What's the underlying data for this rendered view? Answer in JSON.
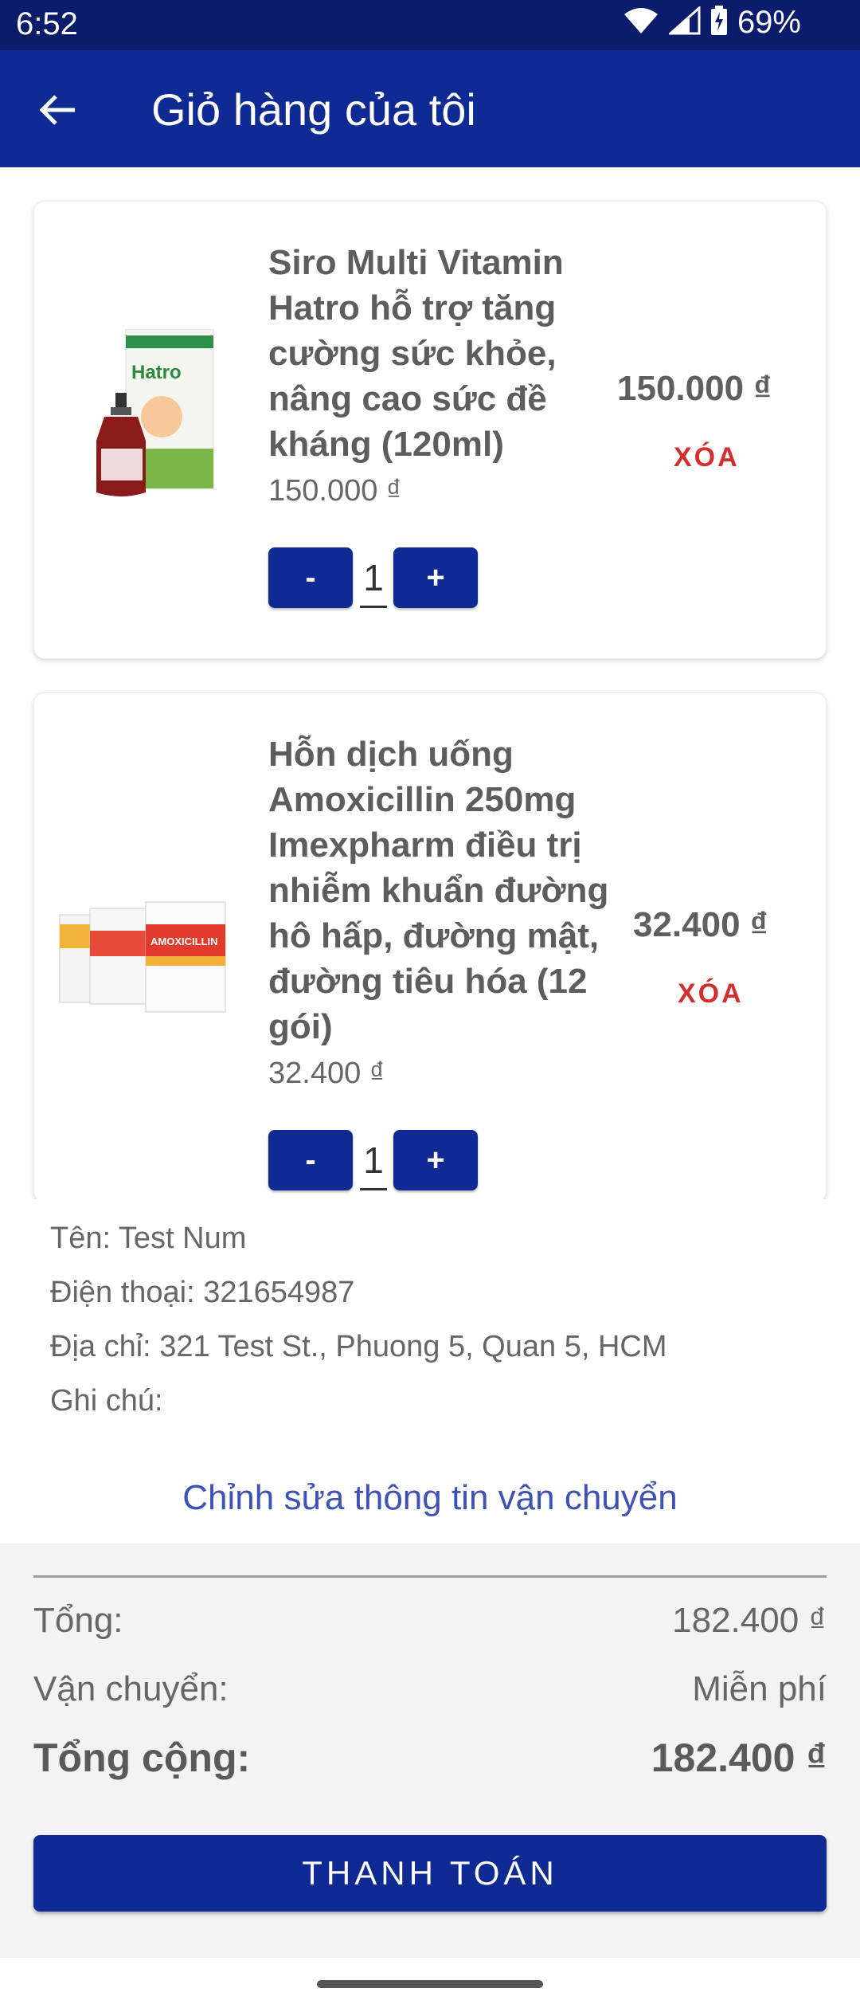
{
  "status_bar": {
    "time": "6:52",
    "battery": "69%"
  },
  "app_bar": {
    "title": "Giỏ hàng của tôi"
  },
  "cart_items": [
    {
      "name": "Siro Multi Vitamin Hatro hỗ trợ tăng cường sức khỏe, nâng cao sức đề kháng (120ml)",
      "unit_price": "150.000 ₫",
      "line_price": "150.000 ₫",
      "remove_label": "XÓA",
      "quantity": "1",
      "minus": "-",
      "plus": "+",
      "image_label": "Hatro"
    },
    {
      "name": "Hỗn dịch uống Amoxicillin 250mg Imexpharm điều trị nhiễm khuẩn đường hô hấp, đường mật, đường tiêu hóa (12 gói)",
      "unit_price": "32.400 ₫",
      "line_price": "32.400 ₫",
      "remove_label": "XÓA",
      "quantity": "1",
      "minus": "-",
      "plus": "+",
      "image_label": "AMOXICILLIN"
    }
  ],
  "shipping_info": {
    "name": "Tên: Test Num",
    "phone": "Điện thoại: 321654987",
    "address": "Địa chỉ: 321 Test St., Phuong 5, Quan 5, HCM",
    "note": "Ghi chú:",
    "edit_link": "Chỉnh sửa thông tin vận chuyển"
  },
  "summary": {
    "subtotal_label": "Tổng:",
    "subtotal_value": "182.400 ₫",
    "shipping_label": "Vận chuyển:",
    "shipping_value": "Miễn phí",
    "total_label": "Tổng cộng:",
    "total_value": "182.400 ₫",
    "pay_button": "THANH TOÁN"
  },
  "colors": {
    "primary": "#0f2a93",
    "status": "#0b1c6b",
    "danger": "#d32f2f",
    "link": "#3f51b5"
  }
}
